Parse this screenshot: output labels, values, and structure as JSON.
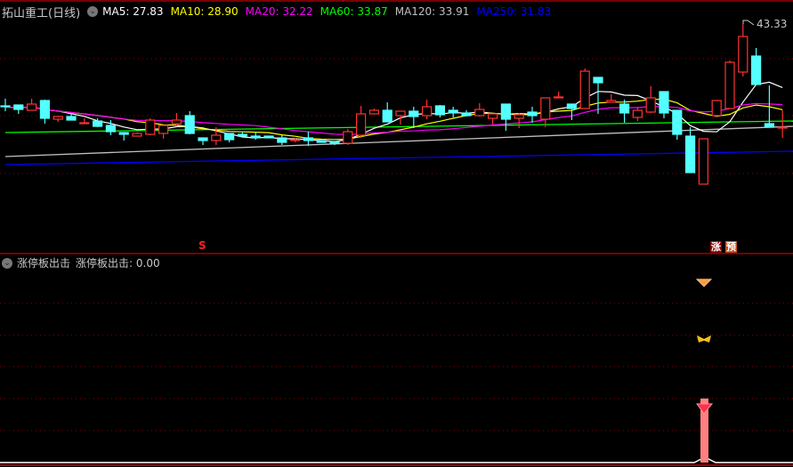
{
  "header": {
    "title": "拓山重工(日线)",
    "indicators": [
      {
        "label": "MA5: 27.83",
        "color": "#ffffff"
      },
      {
        "label": "MA10: 28.90",
        "color": "#ffff00"
      },
      {
        "label": "MA20: 32.22",
        "color": "#ff00ff"
      },
      {
        "label": "MA60: 33.87",
        "color": "#00ff00"
      },
      {
        "label": "MA120: 33.91",
        "color": "#c0c0c0"
      },
      {
        "label": "MA250: 31.83",
        "color": "#0000ff"
      }
    ]
  },
  "main_chart": {
    "high_label": "43.33",
    "signal_s": "S",
    "marker_zhang": "涨",
    "marker_yu": "预",
    "colors": {
      "up": "#ff3232",
      "down": "#54ffff",
      "grid": "#8b0000"
    },
    "candles_ohlc_note": "open, close, high, low",
    "candles": [
      [
        35.97,
        35.89,
        36.61,
        35.49
      ],
      [
        36.05,
        35.65,
        36.05,
        35.25
      ],
      [
        35.57,
        36.13,
        36.61,
        35.57
      ],
      [
        36.45,
        34.85,
        36.53,
        34.37
      ],
      [
        34.77,
        35.01,
        35.01,
        34.53
      ],
      [
        35.01,
        34.69,
        35.25,
        34.69
      ],
      [
        34.37,
        34.45,
        34.85,
        34.37
      ],
      [
        34.61,
        34.13,
        34.85,
        34.05
      ],
      [
        34.21,
        33.65,
        34.69,
        33.33
      ],
      [
        33.57,
        33.41,
        33.57,
        32.85
      ],
      [
        33.25,
        33.49,
        33.57,
        33.25
      ],
      [
        33.41,
        34.69,
        34.85,
        33.33
      ],
      [
        33.49,
        34.21,
        34.21,
        33.01
      ],
      [
        34.37,
        34.69,
        35.33,
        34.21
      ],
      [
        35.09,
        33.49,
        35.49,
        33.41
      ],
      [
        33.09,
        32.85,
        33.09,
        32.45
      ],
      [
        32.85,
        33.33,
        34.05,
        32.45
      ],
      [
        33.49,
        32.93,
        33.49,
        32.69
      ],
      [
        33.41,
        33.25,
        33.65,
        33.25
      ],
      [
        33.25,
        33.09,
        33.65,
        32.93
      ],
      [
        33.25,
        33.09,
        33.25,
        33.09
      ],
      [
        33.09,
        32.69,
        33.33,
        32.45
      ],
      [
        32.85,
        32.93,
        33.09,
        32.69
      ],
      [
        33.09,
        32.85,
        33.65,
        32.37
      ],
      [
        32.85,
        32.69,
        32.85,
        32.69
      ],
      [
        32.77,
        32.61,
        32.77,
        32.45
      ],
      [
        32.61,
        33.65,
        33.89,
        32.45
      ],
      [
        33.33,
        35.25,
        35.97,
        33.09
      ],
      [
        35.25,
        35.57,
        35.73,
        35.25
      ],
      [
        35.57,
        34.53,
        36.29,
        34.53
      ],
      [
        35.09,
        35.49,
        35.49,
        34.29
      ],
      [
        35.49,
        35.01,
        35.89,
        33.97
      ],
      [
        35.09,
        35.89,
        36.53,
        34.77
      ],
      [
        35.97,
        35.17,
        36.05,
        34.93
      ],
      [
        35.57,
        35.33,
        35.89,
        34.93
      ],
      [
        35.33,
        35.09,
        35.57,
        35.01
      ],
      [
        35.09,
        35.65,
        36.21,
        35.01
      ],
      [
        34.85,
        35.25,
        35.25,
        34.29
      ],
      [
        36.13,
        34.77,
        36.13,
        33.73
      ],
      [
        34.85,
        35.17,
        35.33,
        33.97
      ],
      [
        35.41,
        35.09,
        35.89,
        34.45
      ],
      [
        34.77,
        36.69,
        36.69,
        34.05
      ],
      [
        36.69,
        36.77,
        37.25,
        36.69
      ],
      [
        36.13,
        35.73,
        36.13,
        34.69
      ],
      [
        35.73,
        39.09,
        39.33,
        35.73
      ],
      [
        38.53,
        38.05,
        38.53,
        35.25
      ],
      [
        36.29,
        36.45,
        37.01,
        36.29
      ],
      [
        36.13,
        35.33,
        36.53,
        34.45
      ],
      [
        34.93,
        35.57,
        35.89,
        34.61
      ],
      [
        35.41,
        36.69,
        37.73,
        35.33
      ],
      [
        37.25,
        35.33,
        37.25,
        34.85
      ],
      [
        35.57,
        33.41,
        35.57,
        32.93
      ],
      [
        33.25,
        29.97,
        34.05,
        29.97
      ],
      [
        28.93,
        33.01,
        33.01,
        28.93
      ],
      [
        35.09,
        36.45,
        36.45,
        35.09
      ],
      [
        35.73,
        39.89,
        40.05,
        35.73
      ],
      [
        39.01,
        42.21,
        43.33,
        38.61
      ],
      [
        40.45,
        37.89,
        41.17,
        37.89
      ],
      [
        34.37,
        34.05,
        37.81,
        34.05
      ],
      [
        33.97,
        34.05,
        35.57,
        33.09
      ]
    ],
    "long_ma": {
      "ma60": [
        33.57,
        34.61
      ],
      "ma120": [
        31.41,
        34.13
      ],
      "ma250": [
        30.69,
        31.89
      ]
    }
  },
  "sub_chart": {
    "name": "涨停板出击",
    "value_label": "涨停板出击: 0.00",
    "signal_bar_value": 1.0
  }
}
